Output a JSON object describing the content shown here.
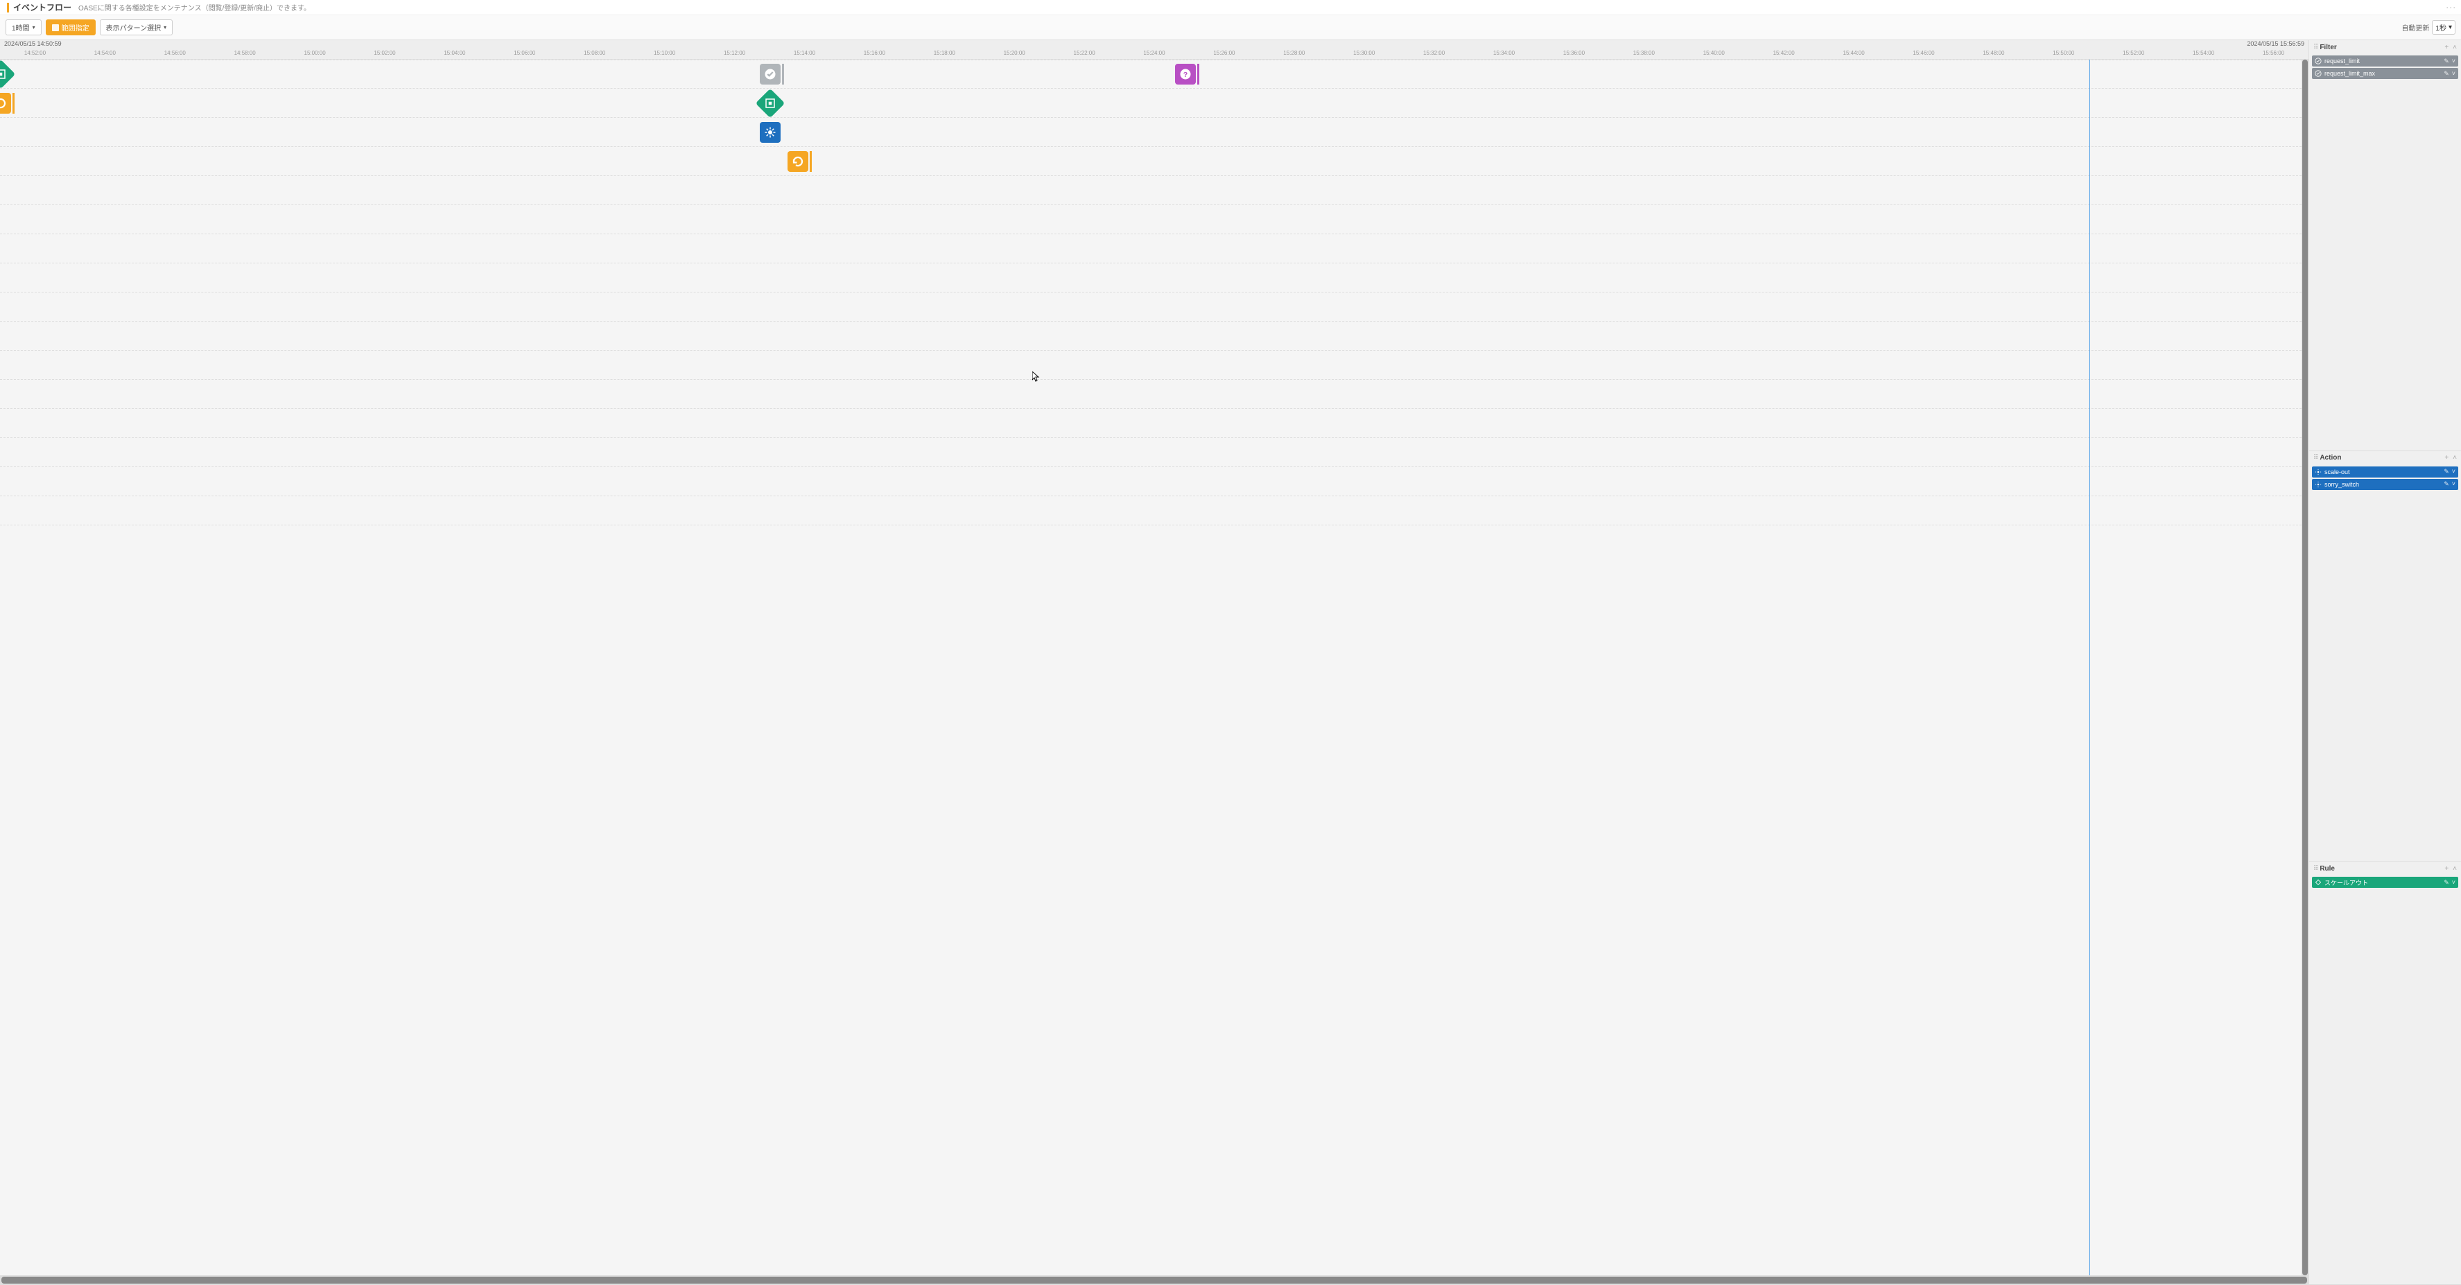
{
  "header": {
    "title": "イベントフロー",
    "description": "OASEに関する各種設定をメンテナンス（閲覧/登録/更新/廃止）できます。"
  },
  "toolbar": {
    "range_button": "1時間",
    "period_button": "範囲指定",
    "pattern_button": "表示パターン選択",
    "auto_refresh_label": "自動更新",
    "refresh_interval": "1秒"
  },
  "timeline": {
    "start_ts": "2024/05/15 14:50:59",
    "end_ts": "2024/05/15 15:56:59",
    "ticks": [
      "14:52:00",
      "14:54:00",
      "14:56:00",
      "14:58:00",
      "15:00:00",
      "15:02:00",
      "15:04:00",
      "15:06:00",
      "15:08:00",
      "15:10:00",
      "15:12:00",
      "15:14:00",
      "15:16:00",
      "15:18:00",
      "15:20:00",
      "15:22:00",
      "15:24:00",
      "15:26:00",
      "15:28:00",
      "15:30:00",
      "15:32:00",
      "15:34:00",
      "15:36:00",
      "15:38:00",
      "15:40:00",
      "15:42:00",
      "15:44:00",
      "15:46:00",
      "15:48:00",
      "15:50:00",
      "15:52:00",
      "15:54:00",
      "15:56:00"
    ],
    "now_line_pct": 90.5,
    "lanes": 16,
    "events": [
      {
        "lane": 0,
        "type": "green",
        "left_pct": 0.0,
        "cut": true,
        "bar": false
      },
      {
        "lane": 0,
        "type": "gray",
        "left_pct": 32.9,
        "bar": true,
        "bar_color": "gray"
      },
      {
        "lane": 0,
        "type": "purple",
        "left_pct": 50.9,
        "bar": true,
        "bar_color": "purple"
      },
      {
        "lane": 1,
        "type": "orange",
        "left_pct": 0.5,
        "cut": true,
        "bar": true,
        "bar_color": "orange"
      },
      {
        "lane": 1,
        "type": "green",
        "left_pct": 32.9,
        "bar": false
      },
      {
        "lane": 2,
        "type": "blue",
        "left_pct": 32.9,
        "bar": false
      },
      {
        "lane": 3,
        "type": "orange",
        "left_pct": 34.1,
        "bar": true,
        "bar_color": "orange"
      }
    ]
  },
  "panels": {
    "filter": {
      "title": "Filter",
      "items": [
        {
          "label": "request_limit"
        },
        {
          "label": "request_limit_max"
        }
      ]
    },
    "action": {
      "title": "Action",
      "items": [
        {
          "label": "scale-out"
        },
        {
          "label": "sorry_switch"
        }
      ]
    },
    "rule": {
      "title": "Rule",
      "items": [
        {
          "label": "スケールアウト"
        }
      ]
    }
  }
}
